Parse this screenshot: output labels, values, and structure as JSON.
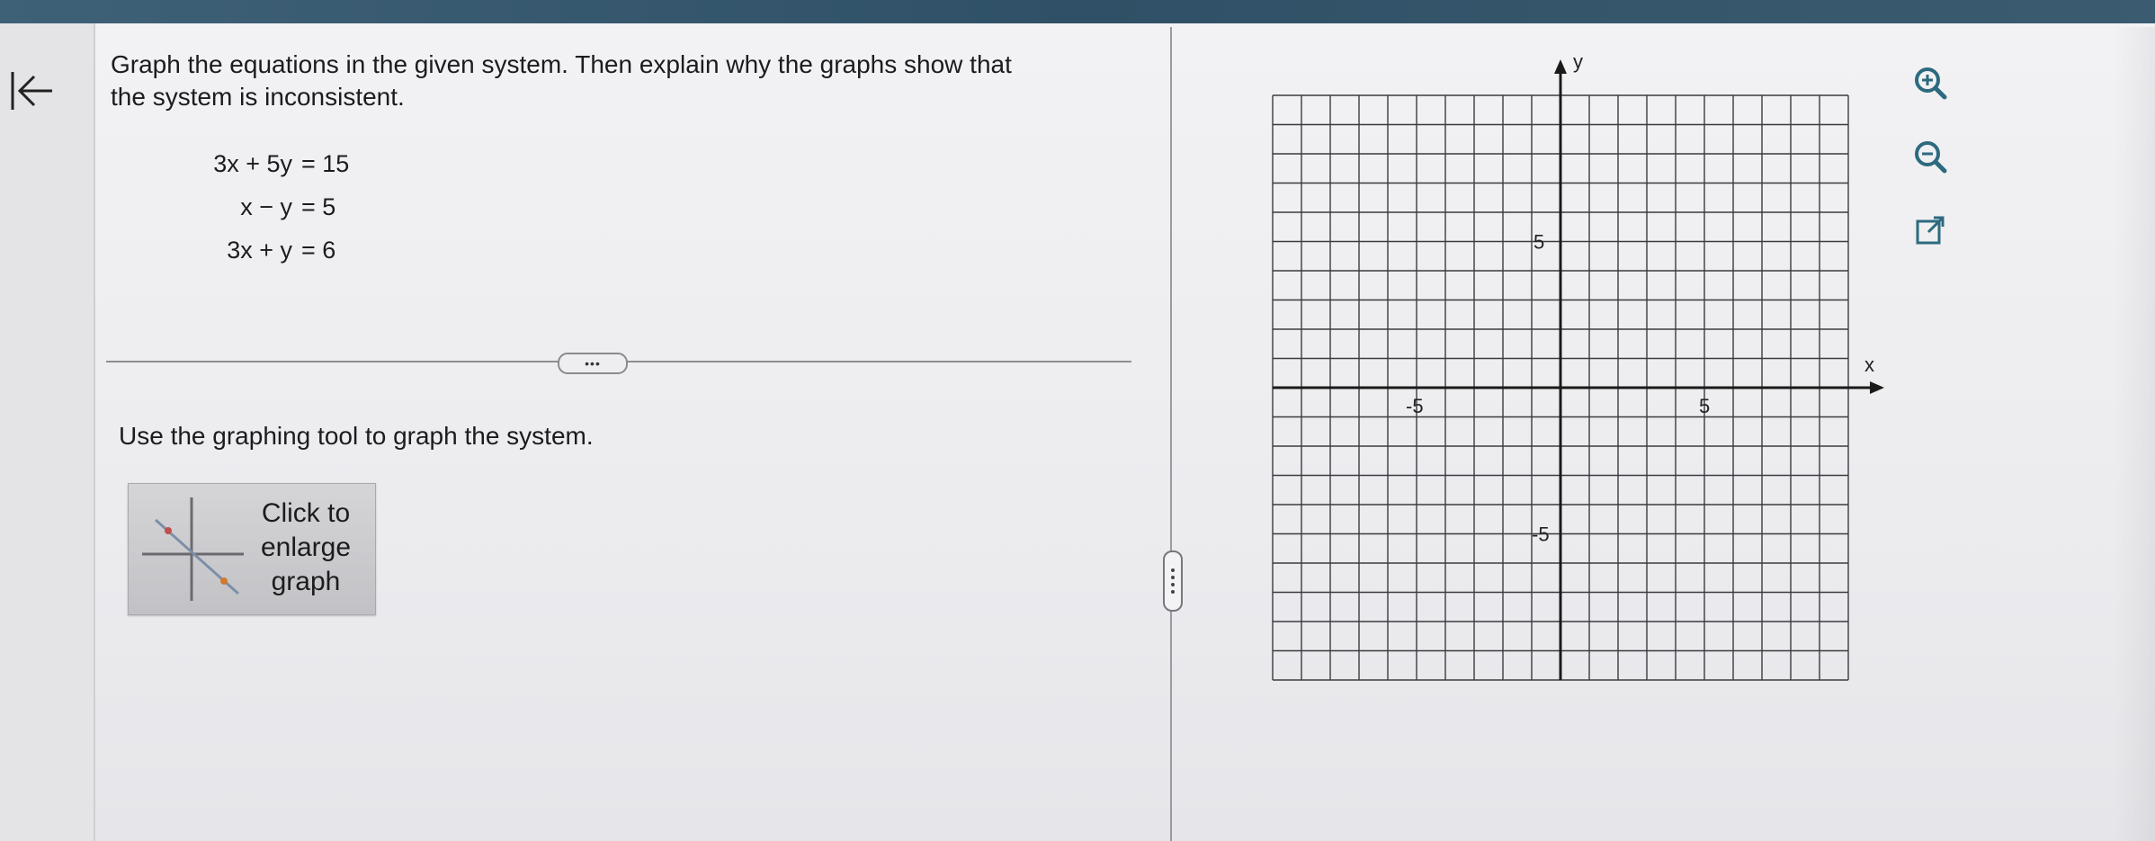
{
  "question": {
    "line1": "Graph the equations in the given system. Then explain why the graphs show that",
    "line2": "the system is inconsistent."
  },
  "equations": [
    {
      "lhs": "3x + 5y",
      "rhs": "= 15"
    },
    {
      "lhs": "x − y",
      "rhs": "= 5"
    },
    {
      "lhs": "3x + y",
      "rhs": "= 6"
    }
  ],
  "more_label": "•••",
  "instruction": "Use the graphing tool to graph the system.",
  "enlarge_button": {
    "line1": "Click to",
    "line2": "enlarge",
    "line3": "graph"
  },
  "graph": {
    "x_axis_label": "x",
    "y_axis_label": "y",
    "x_range": [
      -10,
      10
    ],
    "y_range": [
      -10,
      10
    ],
    "grid_step": 1,
    "tick_labels": {
      "x_neg": "-5",
      "x_pos": "5",
      "y_pos": "5",
      "y_neg": "-5"
    }
  },
  "tool_icons": [
    "zoom-in-icon",
    "zoom-out-icon",
    "external-link-icon"
  ],
  "colors": {
    "accent": "#3f6177",
    "grid": "#3b3b40",
    "icon": "#2d6a7f"
  }
}
